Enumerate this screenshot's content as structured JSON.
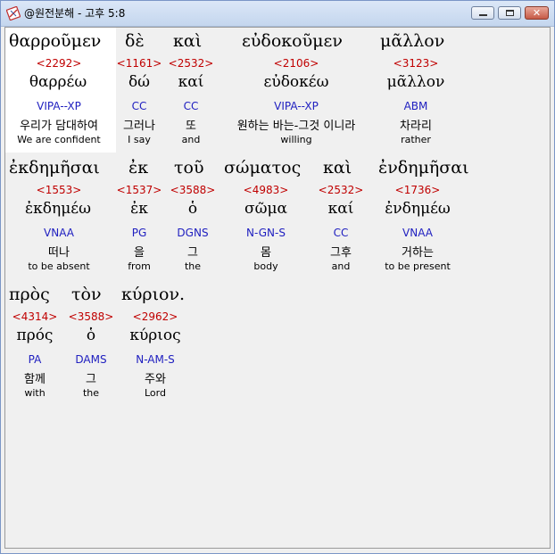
{
  "window": {
    "title": "@원전분해 - 고후 5:8",
    "accent": "#c00000",
    "parse_color": "#2020c0"
  },
  "rows": [
    {
      "words": [
        {
          "greek": "θαρροῦμεν",
          "strong": "<2292>",
          "lemma": "θαρρέω",
          "parse": "VIPA--XP",
          "korean": "우리가 담대하여",
          "english": "We are confident"
        },
        {
          "greek": "δὲ",
          "strong": "<1161>",
          "lemma": "δώ",
          "parse": "CC",
          "korean": "그러나",
          "english": "I say"
        },
        {
          "greek": "καὶ",
          "strong": "<2532>",
          "lemma": "καί",
          "parse": "CC",
          "korean": "또",
          "english": "and"
        },
        {
          "greek": "εὐδοκοῦμεν",
          "strong": "<2106>",
          "lemma": "εὐδοκέω",
          "parse": "VIPA--XP",
          "korean": "원하는 바는-그것 이니라",
          "english": "willing"
        },
        {
          "greek": "μᾶλλον",
          "strong": "<3123>",
          "lemma": "μᾶλλον",
          "parse": "ABM",
          "korean": "차라리",
          "english": "rather"
        }
      ]
    },
    {
      "words": [
        {
          "greek": "ἐκδημῆσαι",
          "strong": "<1553>",
          "lemma": "ἐκδημέω",
          "parse": "VNAA",
          "korean": "떠나",
          "english": "to be absent"
        },
        {
          "greek": "ἐκ",
          "strong": "<1537>",
          "lemma": "ἐκ",
          "parse": "PG",
          "korean": "을",
          "english": "from"
        },
        {
          "greek": "τοῦ",
          "strong": "<3588>",
          "lemma": "ὁ",
          "parse": "DGNS",
          "korean": "그",
          "english": "the"
        },
        {
          "greek": "σώματος",
          "strong": "<4983>",
          "lemma": "σῶμα",
          "parse": "N-GN-S",
          "korean": "몸",
          "english": "body"
        },
        {
          "greek": "καὶ",
          "strong": "<2532>",
          "lemma": "καί",
          "parse": "CC",
          "korean": "그후",
          "english": "and"
        },
        {
          "greek": "ἐνδημῆσαι",
          "strong": "<1736>",
          "lemma": "ἐνδημέω",
          "parse": "VNAA",
          "korean": "거하는",
          "english": "to be present"
        }
      ]
    },
    {
      "words": [
        {
          "greek": "πρὸς",
          "strong": "<4314>",
          "lemma": "πρός",
          "parse": "PA",
          "korean": "함께",
          "english": "with"
        },
        {
          "greek": "τὸν",
          "strong": "<3588>",
          "lemma": "ὁ",
          "parse": "DAMS",
          "korean": "그",
          "english": "the"
        },
        {
          "greek": "κύριον.",
          "strong": "<2962>",
          "lemma": "κύριος",
          "parse": "N-AM-S",
          "korean": "주와",
          "english": "Lord"
        }
      ]
    }
  ]
}
